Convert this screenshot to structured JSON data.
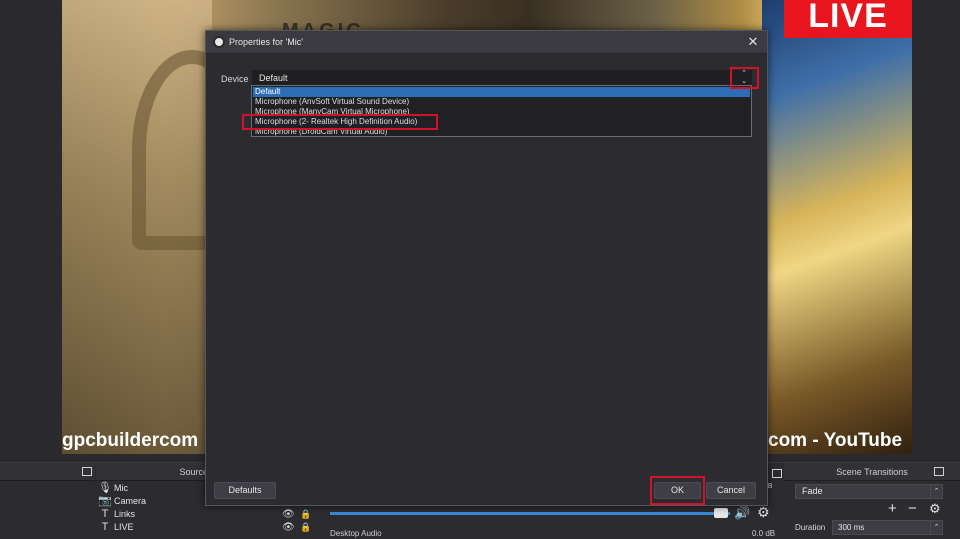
{
  "preview": {
    "live_badge": "LIVE",
    "overlay_left": "gpcbuildercom",
    "overlay_right": "com - YouTube",
    "logo_text": "MAGIC"
  },
  "dialog": {
    "title": "Properties for 'Mic'",
    "device_label": "Device",
    "device_value": "Default",
    "options": [
      "Default",
      "Microphone (AnvSoft Virtual Sound Device)",
      "Microphone (ManyCam Virtual Microphone)",
      "Microphone (2- Realtek High Definition Audio)",
      "Microphone (DroidCam Virtual Audio)"
    ],
    "selected_option": "Default",
    "buttons": {
      "defaults": "Defaults",
      "ok": "OK",
      "cancel": "Cancel"
    },
    "highlight_color": "#d1122a"
  },
  "dock": {
    "sources_header": "Sources",
    "sources": [
      {
        "icon": "mic-icon",
        "label": "Mic"
      },
      {
        "icon": "camera-icon",
        "label": "Camera"
      },
      {
        "icon": "text-icon",
        "label": "Links"
      },
      {
        "icon": "text-icon",
        "label": "LIVE"
      }
    ],
    "mixer": {
      "label": "Desktop Audio",
      "db": "0.0 dB",
      "small_db": "dB"
    },
    "scene_transitions": {
      "header": "Scene Transitions",
      "transition": "Fade",
      "duration_label": "Duration",
      "duration_value": "300 ms"
    }
  },
  "colors": {
    "accent_blue": "#2d6db5",
    "live_red": "#e8141e",
    "panel_bg": "#2b2b30"
  }
}
